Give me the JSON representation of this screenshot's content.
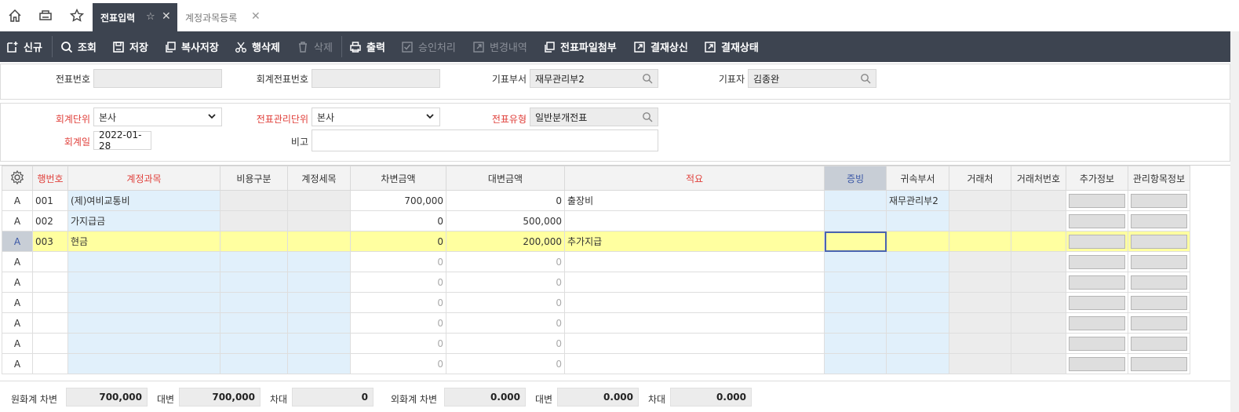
{
  "tabs": [
    {
      "label": "전표입력",
      "active": true
    },
    {
      "label": "계정과목등록",
      "active": false
    }
  ],
  "toolbar": {
    "new": "신규",
    "search": "조회",
    "save": "저장",
    "copy_save": "복사저장",
    "delete_row": "행삭제",
    "delete": "삭제",
    "print": "출력",
    "approve": "승인처리",
    "history": "변경내역",
    "attach": "전표파일첨부",
    "submit": "결재상신",
    "status": "결재상태"
  },
  "header": {
    "voucher_no_label": "전표번호",
    "voucher_no": "",
    "acct_voucher_no_label": "회계전표번호",
    "acct_voucher_no": "",
    "dept_label": "기표부서",
    "dept": "재무관리부2",
    "writer_label": "기표자",
    "writer": "김종완"
  },
  "form": {
    "acct_unit_label": "회계단위",
    "acct_unit": "본사",
    "mgmt_unit_label": "전표관리단위",
    "mgmt_unit": "본사",
    "voucher_type_label": "전표유형",
    "voucher_type": "일반분개전표",
    "acct_date_label": "회계일",
    "acct_date": "2022-01-28",
    "remark_label": "비고",
    "remark": ""
  },
  "grid": {
    "columns": [
      "행번호",
      "계정과목",
      "비용구분",
      "계정세목",
      "차변금액",
      "대변금액",
      "적요",
      "증빙",
      "귀속부서",
      "거래처",
      "거래처번호",
      "추가정보",
      "관리항목정보"
    ],
    "rows": [
      {
        "flag": "A",
        "no": "001",
        "account": "(제)여비교통비",
        "debit": "700,000",
        "credit": "0",
        "memo": "출장비",
        "dept": "재무관리부2"
      },
      {
        "flag": "A",
        "no": "002",
        "account": "가지급금",
        "debit": "0",
        "credit": "500,000",
        "memo": "",
        "dept": ""
      },
      {
        "flag": "A",
        "no": "003",
        "account": "현금",
        "debit": "0",
        "credit": "200,000",
        "memo": "추가지급",
        "dept": ""
      },
      {
        "flag": "A",
        "no": "",
        "account": "",
        "debit": "0",
        "credit": "0",
        "memo": "",
        "dept": ""
      },
      {
        "flag": "A",
        "no": "",
        "account": "",
        "debit": "0",
        "credit": "0",
        "memo": "",
        "dept": ""
      },
      {
        "flag": "A",
        "no": "",
        "account": "",
        "debit": "0",
        "credit": "0",
        "memo": "",
        "dept": ""
      },
      {
        "flag": "A",
        "no": "",
        "account": "",
        "debit": "0",
        "credit": "0",
        "memo": "",
        "dept": ""
      },
      {
        "flag": "A",
        "no": "",
        "account": "",
        "debit": "0",
        "credit": "0",
        "memo": "",
        "dept": ""
      },
      {
        "flag": "A",
        "no": "",
        "account": "",
        "debit": "0",
        "credit": "0",
        "memo": "",
        "dept": ""
      }
    ]
  },
  "footer": {
    "krw_debit_label": "원화계 차변",
    "krw_debit": "700,000",
    "krw_credit_label": "대변",
    "krw_credit": "700,000",
    "krw_diff_label": "차대",
    "krw_diff": "0",
    "fx_debit_label": "외화계 차변",
    "fx_debit": "0.000",
    "fx_credit_label": "대변",
    "fx_credit": "0.000",
    "fx_diff_label": "차대",
    "fx_diff": "0.000"
  },
  "icons": [
    "home-icon",
    "print-tab-icon",
    "star-icon",
    "settings-gear-icon",
    "search-icon"
  ],
  "colors": {
    "toolbar_bg": "#3d4450",
    "required_label": "#e0403b",
    "selected_row": "#ffffa0",
    "editable_cell": "#e1f0fb"
  }
}
